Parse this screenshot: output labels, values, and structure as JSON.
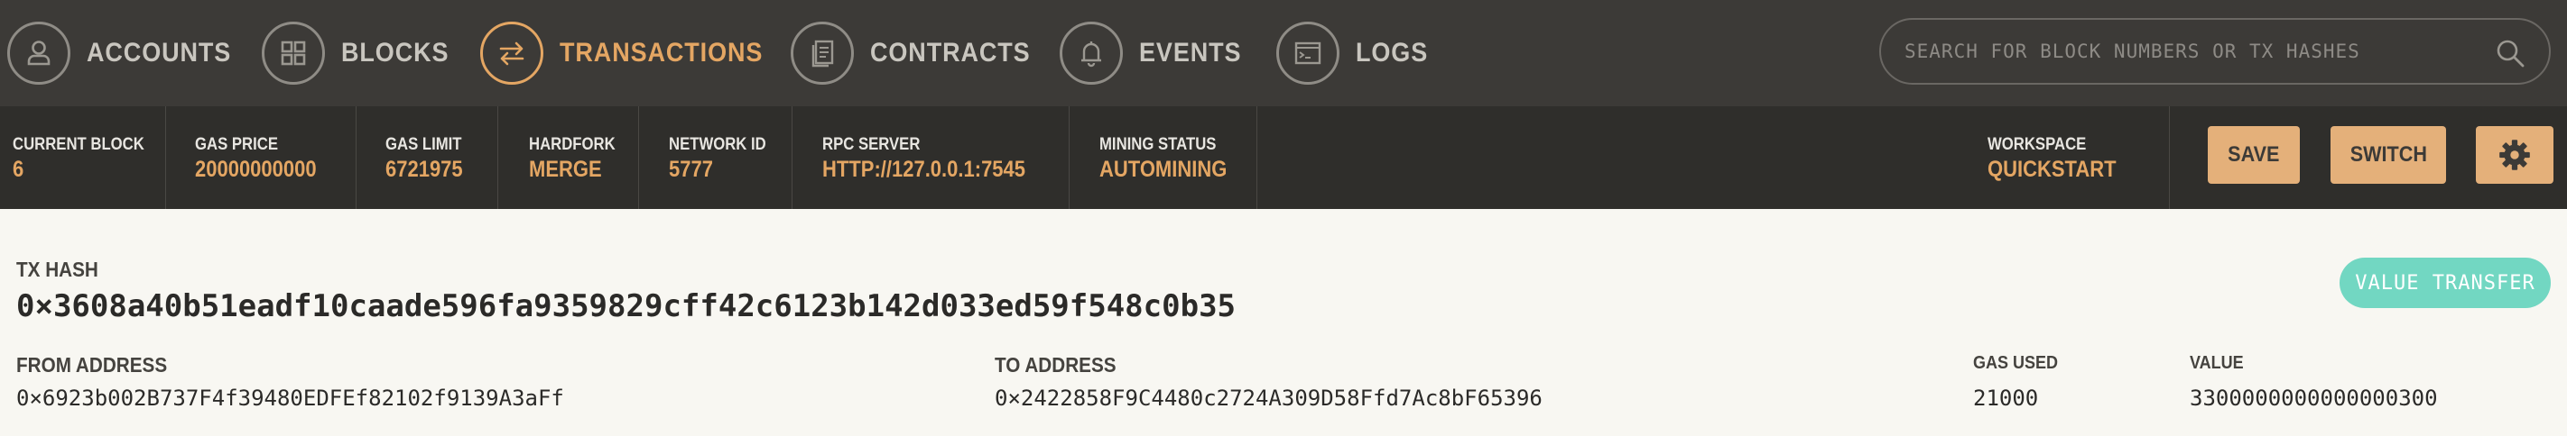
{
  "nav": {
    "items": [
      {
        "label": "ACCOUNTS",
        "icon": "accounts-icon"
      },
      {
        "label": "BLOCKS",
        "icon": "blocks-icon"
      },
      {
        "label": "TRANSACTIONS",
        "icon": "transactions-icon",
        "active": true
      },
      {
        "label": "CONTRACTS",
        "icon": "contracts-icon"
      },
      {
        "label": "EVENTS",
        "icon": "events-icon"
      },
      {
        "label": "LOGS",
        "icon": "logs-icon"
      }
    ],
    "search_placeholder": "SEARCH FOR BLOCK NUMBERS OR TX HASHES"
  },
  "status": {
    "current_block": {
      "label": "CURRENT BLOCK",
      "value": "6"
    },
    "gas_price": {
      "label": "GAS PRICE",
      "value": "20000000000"
    },
    "gas_limit": {
      "label": "GAS LIMIT",
      "value": "6721975"
    },
    "hardfork": {
      "label": "HARDFORK",
      "value": "MERGE"
    },
    "network_id": {
      "label": "NETWORK ID",
      "value": "5777"
    },
    "rpc_server": {
      "label": "RPC SERVER",
      "value": "HTTP://127.0.0.1:7545"
    },
    "mining_status": {
      "label": "MINING STATUS",
      "value": "AUTOMINING"
    },
    "workspace": {
      "label": "WORKSPACE",
      "value": "QUICKSTART"
    },
    "save_label": "SAVE",
    "switch_label": "SWITCH"
  },
  "transaction": {
    "hash_label": "TX HASH",
    "hash": "0×3608a40b51eadf10caade596fa9359829cff42c6123b142d033ed59f548c0b35",
    "type_badge": "VALUE TRANSFER",
    "from_label": "FROM ADDRESS",
    "from": "0×6923b002B737F4f39480EDFEf82102f9139A3aFf",
    "to_label": "TO ADDRESS",
    "to": "0×2422858F9C4480c2724A309D58Ffd7Ac8bF65396",
    "gas_used_label": "GAS USED",
    "gas_used": "21000",
    "value_label": "VALUE",
    "value": "3300000000000000300"
  },
  "colors": {
    "nav_bg": "#3c3a37",
    "status_bg": "#2f2e2b",
    "accent": "#e4a663",
    "badge": "#72d7c2",
    "content_bg": "#f8f7f2"
  }
}
